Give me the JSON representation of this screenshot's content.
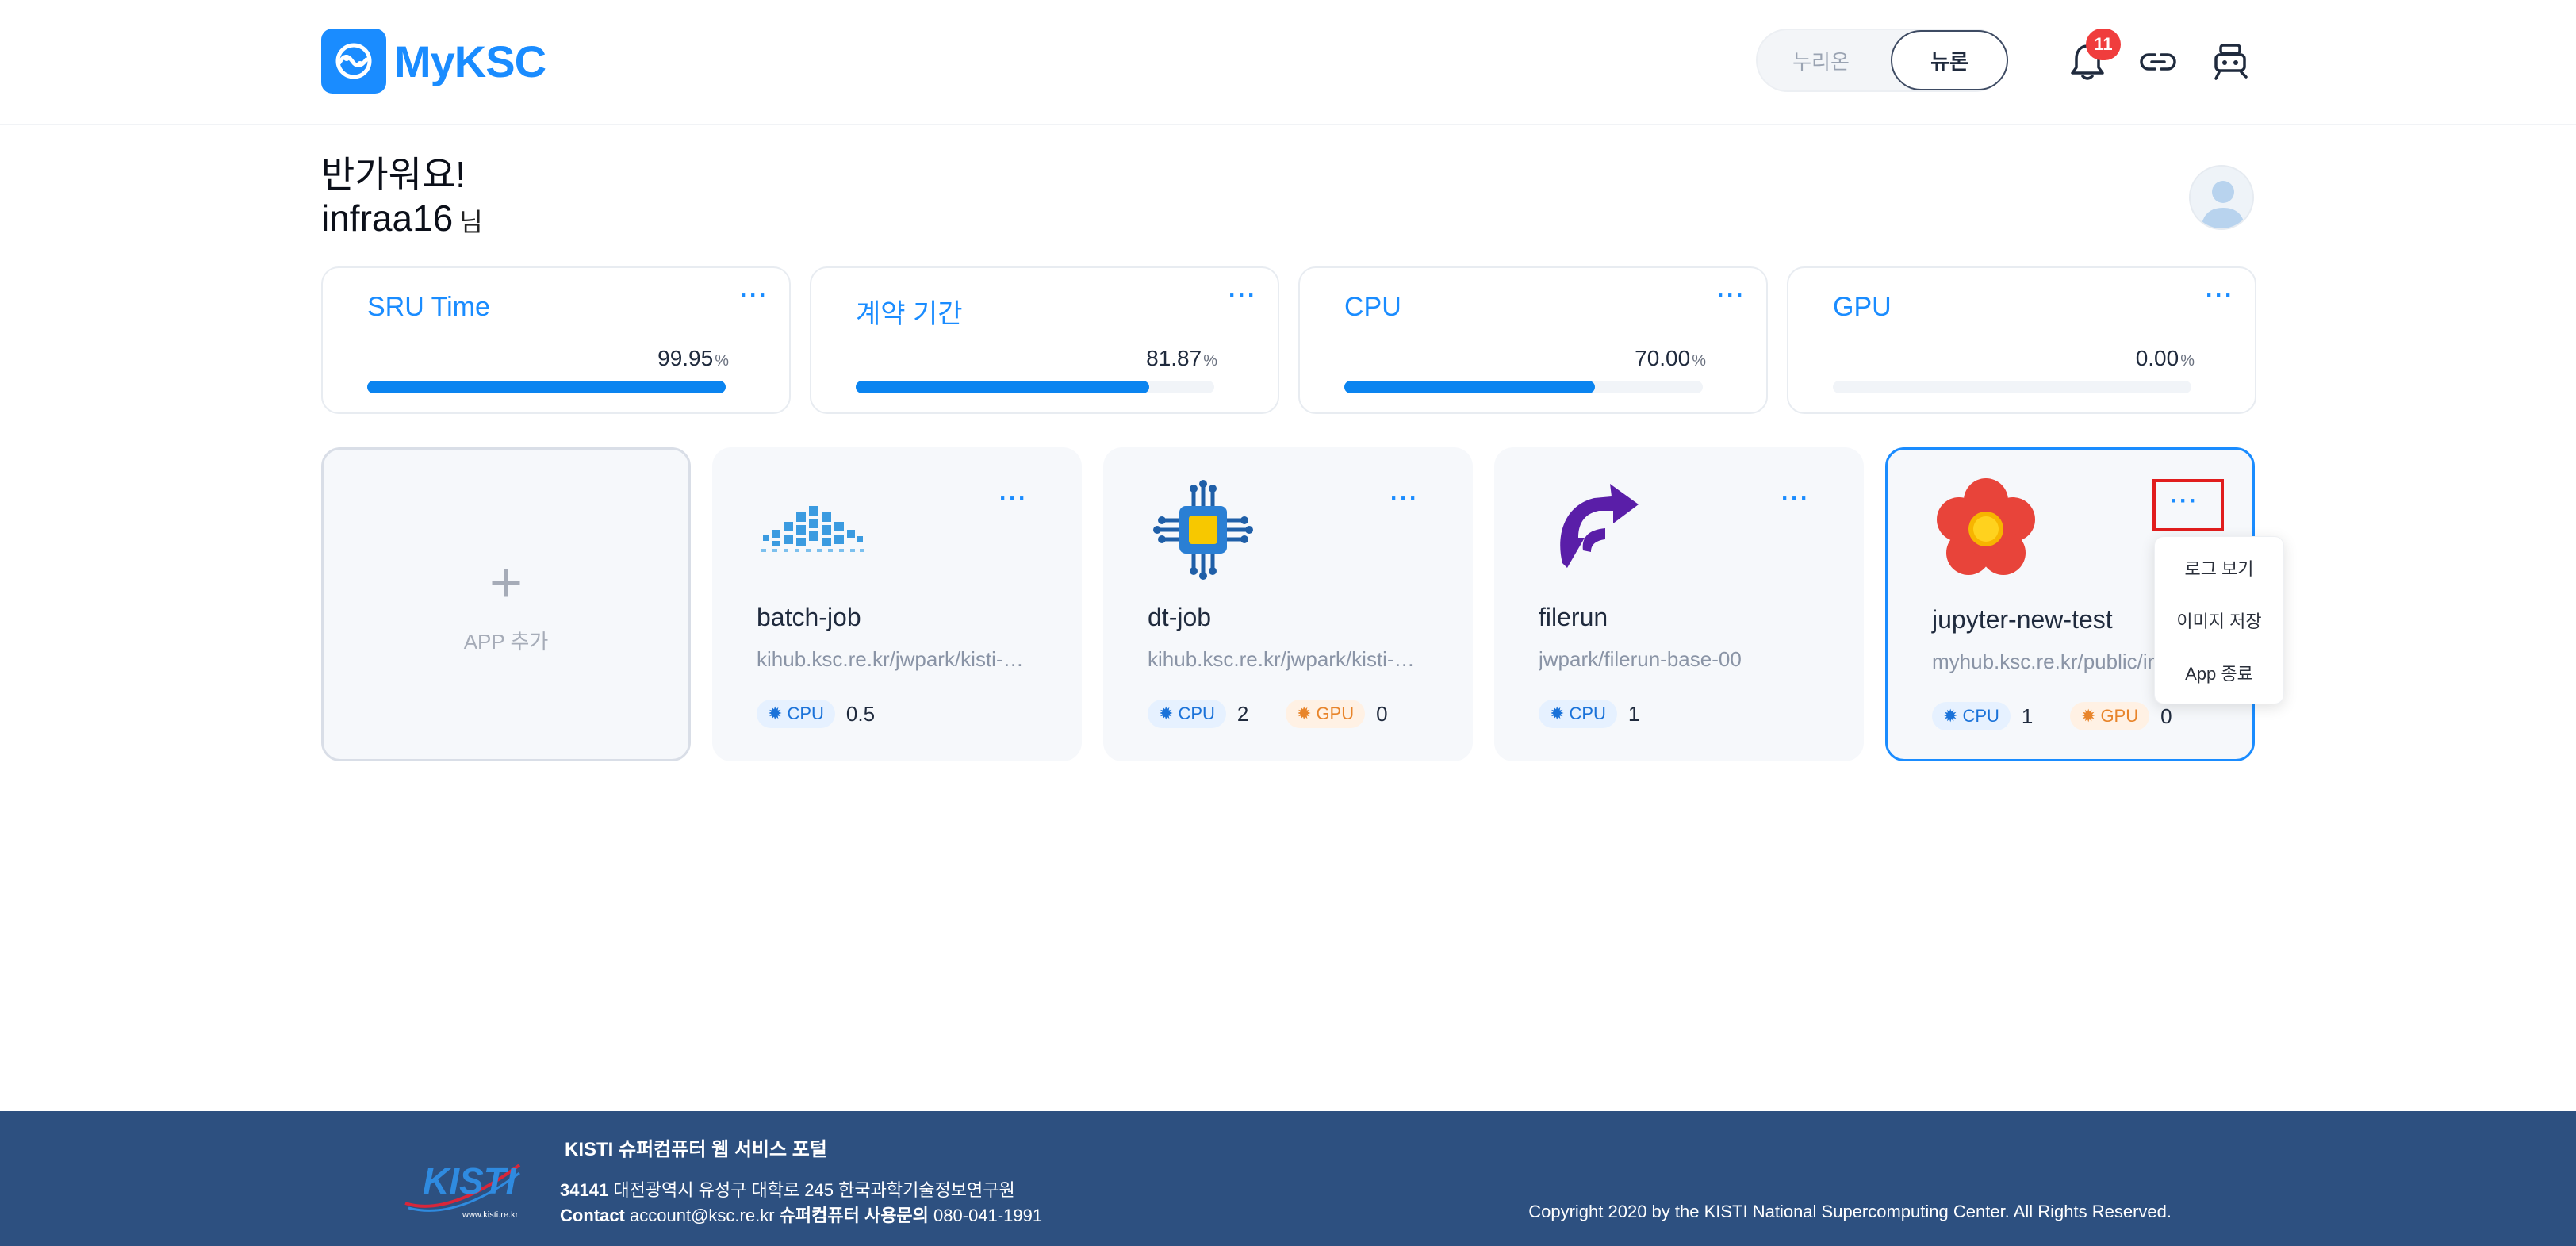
{
  "brand": {
    "name": "MyKSC"
  },
  "header": {
    "system_toggle": {
      "options": [
        "누리온",
        "뉴론"
      ],
      "selected": "뉴론"
    },
    "notifications_count": "11"
  },
  "greeting": {
    "line1": "반가워요!",
    "username": "infraa16",
    "honorific": "님"
  },
  "stats": [
    {
      "title": "SRU Time",
      "value": "99.95",
      "unit": "%",
      "progress": 0.9995
    },
    {
      "title": "계약 기간",
      "value": "81.87",
      "unit": "%",
      "progress": 0.8187
    },
    {
      "title": "CPU",
      "value": "70.00",
      "unit": "%",
      "progress": 0.7
    },
    {
      "title": "GPU",
      "value": "0.00",
      "unit": "%",
      "progress": 0.0
    }
  ],
  "more_label": "···",
  "apps": {
    "add_label": "APP 추가",
    "add_symbol": "+",
    "items": [
      {
        "name": "batch-job",
        "image": "kihub.ksc.re.kr/jwpark/kisti-batch-job",
        "cpu_label": "CPU",
        "cpu": "0.5",
        "icon": "batch-wave-icon"
      },
      {
        "name": "dt-job",
        "image": "kihub.ksc.re.kr/jwpark/kisti-dt-job",
        "cpu_label": "CPU",
        "cpu": "2",
        "gpu_label": "GPU",
        "gpu": "0",
        "icon": "chip-icon"
      },
      {
        "name": "filerun",
        "image": "jwpark/filerun-base-00",
        "cpu_label": "CPU",
        "cpu": "1",
        "icon": "filerun-arrow-icon"
      },
      {
        "name": "jupyter-new-test",
        "image": "myhub.ksc.re.kr/public/image",
        "cpu_label": "CPU",
        "cpu": "1",
        "gpu_label": "GPU",
        "gpu": "0",
        "icon": "flower-icon"
      }
    ]
  },
  "context_menu": {
    "items": [
      "로그 보기",
      "이미지 저장",
      "App 종료"
    ]
  },
  "footer": {
    "logo_text": "KISTI",
    "logo_sub": "www.kisti.re.kr",
    "title": "KISTI 슈퍼컴퓨터 웹 서비스 포털",
    "postcode": "34141",
    "address": "대전광역시 유성구 대학로 245 한국과학기술정보연구원",
    "contact_label": "Contact",
    "email": "account@ksc.re.kr",
    "support_label": "슈퍼컴퓨터 사용문의",
    "phone": "080-041-1991",
    "copyright": "Copyright 2020 by the KISTI National Supercomputing Center. All Rights Reserved."
  },
  "colors": {
    "brand": "#1a8cff",
    "footer_bg": "#2d5080",
    "badge": "#f03d3d",
    "cpu_chip": "#e6f1ff",
    "gpu_chip": "#fff1e4"
  }
}
